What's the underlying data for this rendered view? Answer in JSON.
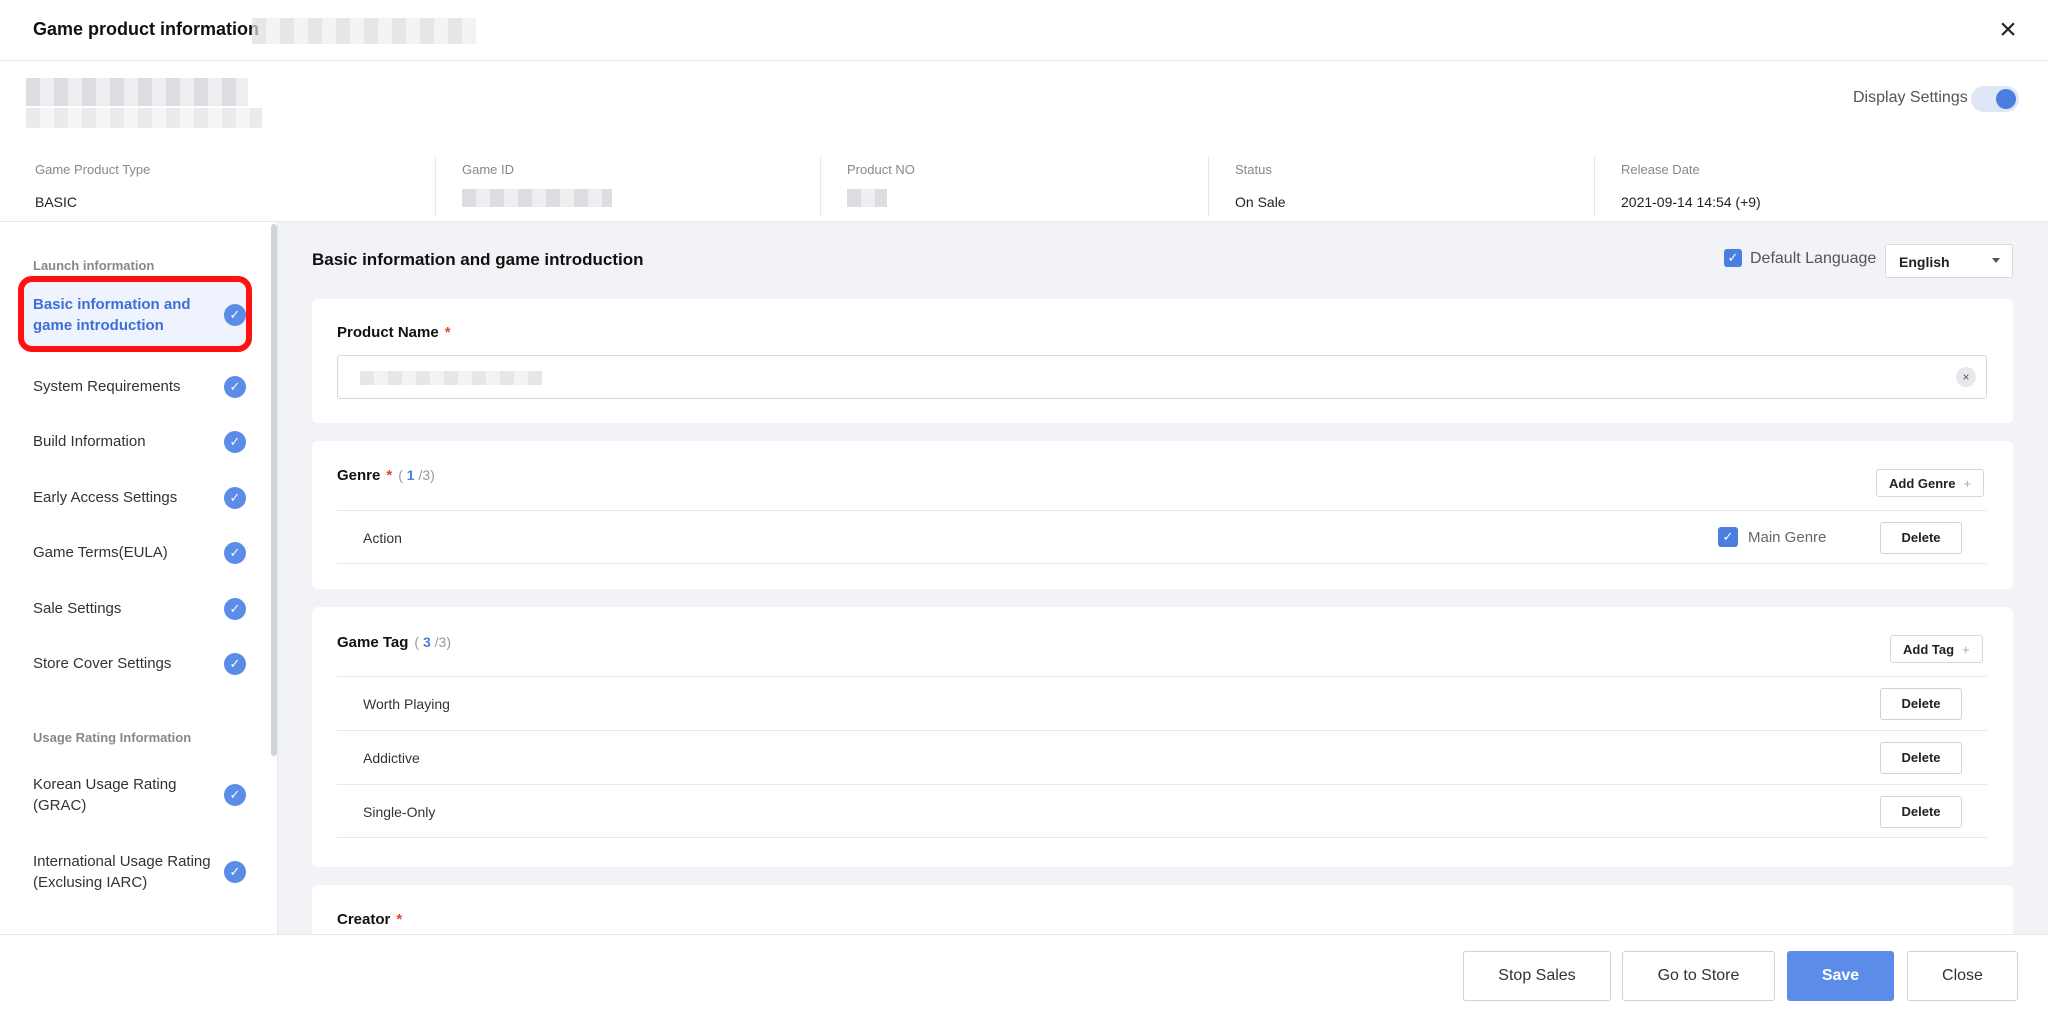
{
  "window": {
    "title": "Game product information"
  },
  "header": {
    "display_settings_label": "Display Settings",
    "display_settings_on": true
  },
  "info": [
    {
      "label": "Game Product Type",
      "value": "BASIC"
    },
    {
      "label": "Game ID",
      "value": ""
    },
    {
      "label": "Product NO",
      "value": ""
    },
    {
      "label": "Status",
      "value": "On Sale"
    },
    {
      "label": "Release Date",
      "value": "2021-09-14 14:54 (+9)"
    }
  ],
  "sidebar": {
    "launch_title": "Launch information",
    "items": [
      {
        "label_line1": "Basic information and",
        "label_line2": "game introduction",
        "active": true,
        "check_icon": "check-circle-icon"
      },
      {
        "label_line1": "System Requirements"
      },
      {
        "label_line1": "Build Information"
      },
      {
        "label_line1": "Early Access Settings"
      },
      {
        "label_line1": "Game Terms(EULA)"
      },
      {
        "label_line1": "Sale Settings"
      },
      {
        "label_line1": "Store Cover Settings"
      }
    ],
    "usage_title": "Usage Rating Information",
    "usage_items": [
      {
        "label_line1": "Korean Usage Rating",
        "label_line2": "(GRAC)"
      },
      {
        "label_line1": "International Usage Rating",
        "label_line2": "(Exclusing IARC)"
      }
    ]
  },
  "main": {
    "title": "Basic information and game introduction",
    "default_language_label": "Default Language",
    "language_value": "English",
    "product_name": {
      "label": "Product Name",
      "required": "*"
    },
    "genre": {
      "label": "Genre",
      "required": "*",
      "count_open": "(",
      "count_current": "1",
      "count_total": "/3)",
      "add_label": "Add Genre",
      "plus": "+",
      "rows": [
        {
          "name": "Action",
          "main_genre_label": "Main Genre",
          "delete_label": "Delete"
        }
      ]
    },
    "game_tag": {
      "label": "Game Tag",
      "count_open": "(",
      "count_current": "3",
      "count_total": "/3)",
      "add_label": "Add Tag",
      "plus": "+",
      "rows": [
        {
          "name": "Worth Playing",
          "delete_label": "Delete"
        },
        {
          "name": "Addictive",
          "delete_label": "Delete"
        },
        {
          "name": "Single-Only",
          "delete_label": "Delete"
        }
      ]
    },
    "creator": {
      "label": "Creator",
      "required": "*"
    }
  },
  "footer": {
    "stop_sales": "Stop Sales",
    "go_to_store": "Go to Store",
    "save": "Save",
    "close": "Close"
  },
  "colors": {
    "accent": "#5b8ce8",
    "required": "#e6452c",
    "highlight": "#ff1111"
  }
}
